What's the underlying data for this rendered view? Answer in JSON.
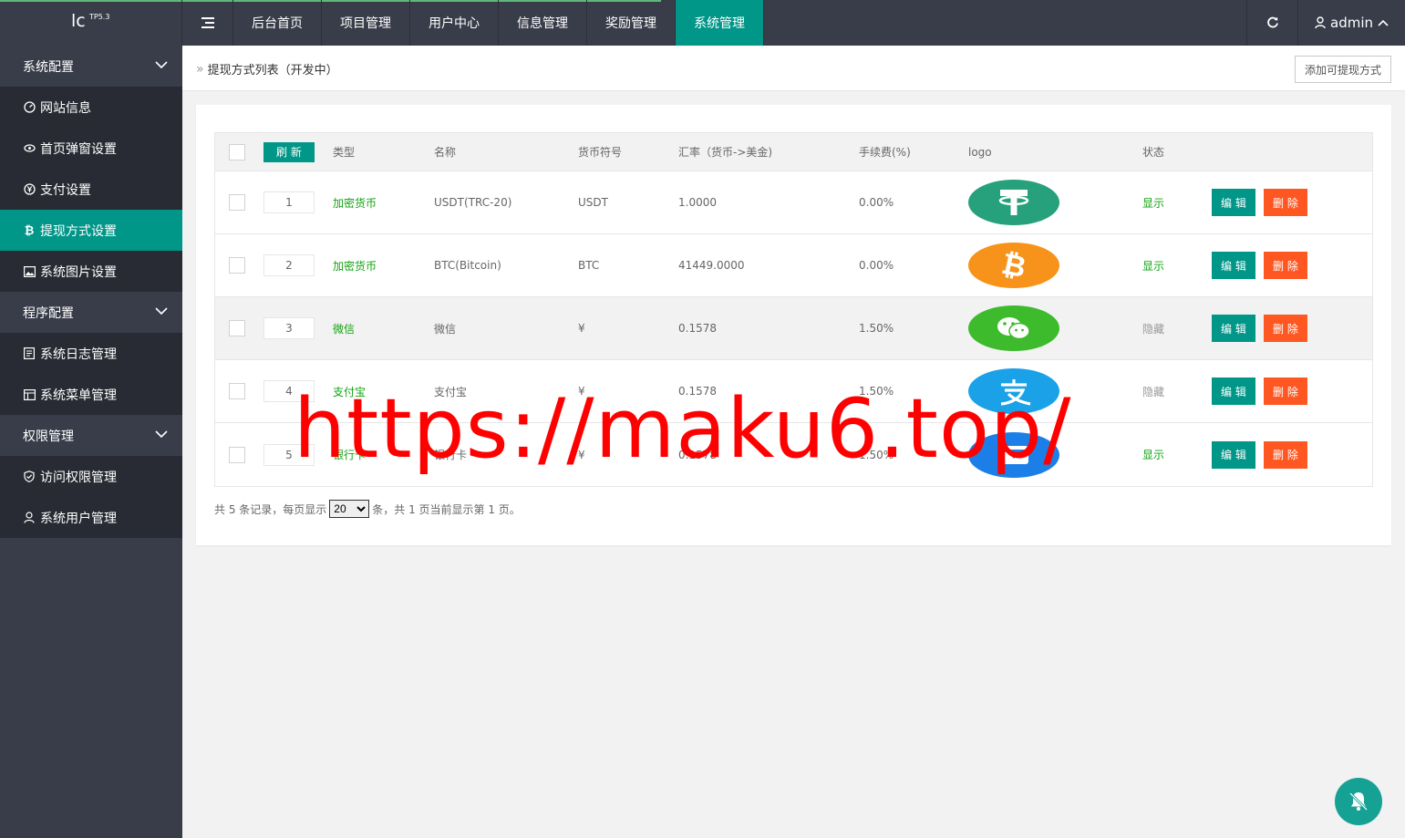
{
  "app": {
    "logo": "lc",
    "version": "TP5.3"
  },
  "topnav": {
    "items": [
      {
        "label": "后台首页"
      },
      {
        "label": "项目管理"
      },
      {
        "label": "用户中心"
      },
      {
        "label": "信息管理"
      },
      {
        "label": "奖励管理"
      },
      {
        "label": "系统管理"
      }
    ],
    "user": "admin"
  },
  "sidebar": {
    "groups": [
      {
        "label": "系统配置",
        "items": [
          {
            "label": "网站信息",
            "icon": "dashboard-icon"
          },
          {
            "label": "首页弹窗设置",
            "icon": "popup-icon"
          },
          {
            "label": "支付设置",
            "icon": "yen-icon"
          },
          {
            "label": "提现方式设置",
            "icon": "bitcoin-icon"
          },
          {
            "label": "系统图片设置",
            "icon": "image-icon"
          }
        ]
      },
      {
        "label": "程序配置",
        "items": [
          {
            "label": "系统日志管理",
            "icon": "log-icon"
          },
          {
            "label": "系统菜单管理",
            "icon": "menu-table-icon"
          }
        ]
      },
      {
        "label": "权限管理",
        "items": [
          {
            "label": "访问权限管理",
            "icon": "shield-icon"
          },
          {
            "label": "系统用户管理",
            "icon": "user-icon"
          }
        ]
      }
    ]
  },
  "breadcrumb": {
    "title": "提现方式列表（开发中）"
  },
  "toolbar": {
    "add_label": "添加可提现方式"
  },
  "table": {
    "refresh_label": "刷 新",
    "columns": [
      "类型",
      "名称",
      "货币符号",
      "汇率（货币->美金)",
      "手续费(%)",
      "logo",
      "状态"
    ],
    "edit_label": "编 辑",
    "delete_label": "删 除",
    "rows": [
      {
        "sort": "1",
        "type": "加密货币",
        "name": "USDT(TRC-20)",
        "symbol": "USDT",
        "rate": "1.0000",
        "fee": "0.00%",
        "logo": "tether-logo",
        "status": "显示"
      },
      {
        "sort": "2",
        "type": "加密货币",
        "name": "BTC(Bitcoin)",
        "symbol": "BTC",
        "rate": "41449.0000",
        "fee": "0.00%",
        "logo": "bitcoin-logo",
        "status": "显示"
      },
      {
        "sort": "3",
        "type": "微信",
        "name": "微信",
        "symbol": "¥",
        "rate": "0.1578",
        "fee": "1.50%",
        "logo": "wechat-logo",
        "status": "隐藏"
      },
      {
        "sort": "4",
        "type": "支付宝",
        "name": "支付宝",
        "symbol": "¥",
        "rate": "0.1578",
        "fee": "1.50%",
        "logo": "alipay-logo",
        "status": "隐藏"
      },
      {
        "sort": "5",
        "type": "银行卡",
        "name": "银行卡",
        "symbol": "¥",
        "rate": "0.1578",
        "fee": "1.50%",
        "logo": "bank-card-logo",
        "status": "显示"
      }
    ]
  },
  "pager": {
    "text_before": "共 5 条记录，每页显示",
    "page_size": "20",
    "text_after": "条，共 1 页当前显示第 1 页。"
  },
  "watermark": "https://maku6.top/",
  "colors": {
    "primary": "#009688",
    "danger": "#ff5722",
    "sidebar": "#393d49",
    "sidebar_sub": "#282b33",
    "status_green": "#12a312"
  }
}
